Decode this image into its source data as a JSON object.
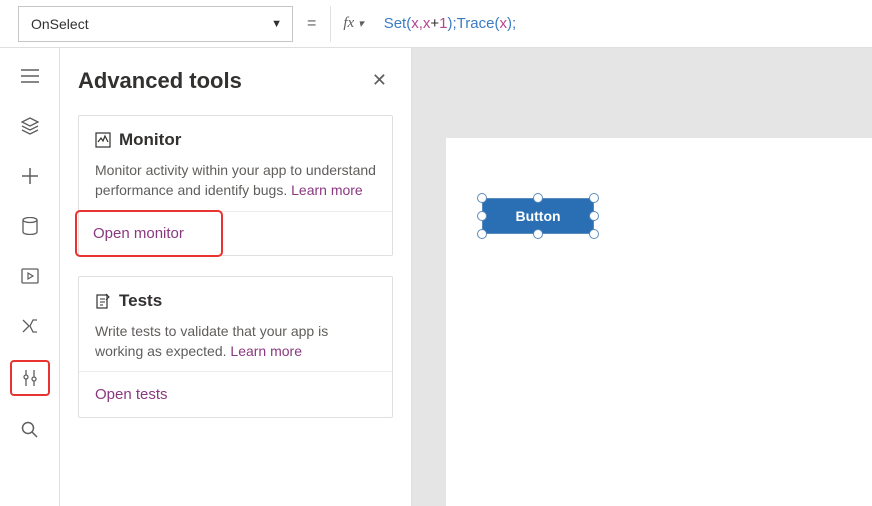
{
  "formula_bar": {
    "property": "OnSelect",
    "equals": "=",
    "fx": "fx",
    "formula_tokens": {
      "set": "Set",
      "lp1": "(",
      "sp": " ",
      "x1": "x",
      "comma": ",",
      "x2": "x",
      "plus": "+",
      "one": "1",
      "rp1": ")",
      "semi1": ";",
      "trace": "Trace",
      "lp2": "(",
      "x3": "x",
      "rp2": ")",
      "semi2": ";"
    }
  },
  "rail": {
    "hamburger": "hamburger-icon",
    "layers": "layers-icon",
    "insert": "plus-icon",
    "data": "database-icon",
    "media": "media-icon",
    "variables": "variables-icon",
    "tools": "tools-icon",
    "search": "search-icon"
  },
  "panel": {
    "title": "Advanced tools",
    "close": "✕",
    "monitor": {
      "title": "Monitor",
      "desc": "Monitor activity within your app to understand performance and identify bugs. ",
      "learn": "Learn more",
      "action": "Open monitor"
    },
    "tests": {
      "title": "Tests",
      "desc": "Write tests to validate that your app is working as expected. ",
      "learn": "Learn more",
      "action": "Open tests"
    }
  },
  "canvas": {
    "button_label": "Button"
  }
}
